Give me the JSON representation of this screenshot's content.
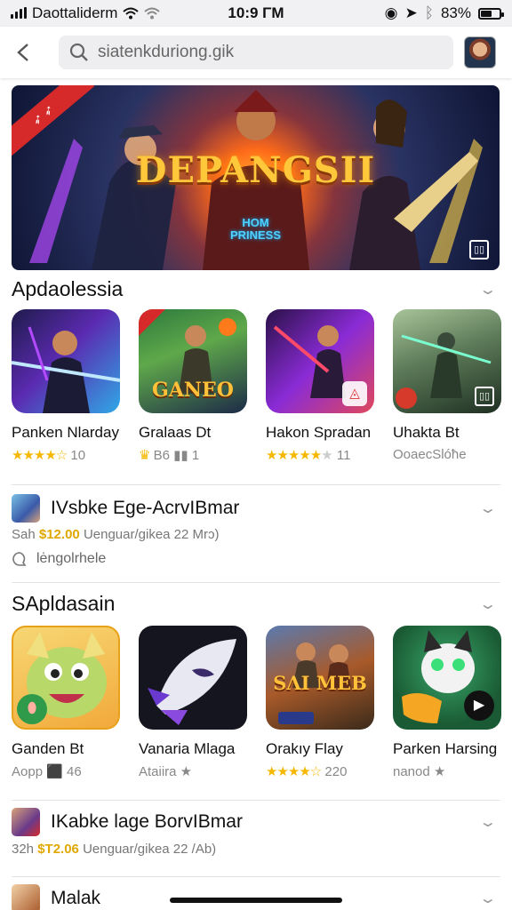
{
  "status_bar": {
    "carrier": "Daottaliderm",
    "time": "10:9 ΓM",
    "battery": "83%"
  },
  "search": {
    "value": "siatenkduriong.gik"
  },
  "hero": {
    "title": "DEPANGSII",
    "subtitle_line1": "HOM",
    "subtitle_line2": "PRINESS"
  },
  "section1": {
    "title": "Apdaolessia",
    "apps": [
      {
        "name": "Panken Nlarday",
        "stars": "★★★★☆",
        "rating": "10",
        "colors": [
          "#3b2b6a",
          "#8a2bd6",
          "#27a3e0"
        ]
      },
      {
        "name": "Gralaas Dt",
        "stars": "♛",
        "rating": "Β6 ▮▮ 1",
        "icon_text": "GANEO",
        "colors": [
          "#2a6a3a",
          "#d58b1d",
          "#1b2a4a"
        ]
      },
      {
        "name": "Hakon Spradan",
        "stars": "★★★★★",
        "rating": "11",
        "colors": [
          "#3a1b5a",
          "#b03ad0",
          "#e04a5a"
        ]
      },
      {
        "name": "Uhakta Bt",
        "stars": "",
        "rating": "OoaecSlóħe",
        "colors": [
          "#3a5a3a",
          "#88b07a",
          "#1f3022"
        ]
      }
    ]
  },
  "list1": {
    "title": "IVsbke Ege-AcrvIBmar",
    "meta_prefix": "Sah",
    "price": "$12.00",
    "meta_suffix": "Uenguar/gikea 22 Mrɔ)",
    "note": "lėngolrhele"
  },
  "section2": {
    "title": "SApldasain",
    "apps": [
      {
        "name": "Ganden Bt",
        "rating": "Aopp ⬛ 46",
        "colors": [
          "#f2c94c",
          "#7ccf50",
          "#e07a2a"
        ]
      },
      {
        "name": "Vanaria Mlaga",
        "rating": "Ataiira ★",
        "colors": [
          "#1c1c2e",
          "#e6e6f0",
          "#7a3ad0"
        ]
      },
      {
        "name": "Orakıy Flay",
        "stars": "★★★★☆",
        "rating": "220",
        "icon_text": "SΛI MEB",
        "colors": [
          "#6a3a2a",
          "#d6a13a",
          "#2a3a5a"
        ]
      },
      {
        "name": "Parken Harsing",
        "rating": "nanod ★",
        "colors": [
          "#1d6a3a",
          "#e6e6e6",
          "#f5a623"
        ]
      }
    ]
  },
  "list2": {
    "title": "IKabke lage BorvIBmar",
    "meta_prefix": "32h",
    "price": "$T2.06",
    "meta_suffix": "Uenguar/gikea 22 /Ab)"
  },
  "list3": {
    "title": "Malak"
  }
}
